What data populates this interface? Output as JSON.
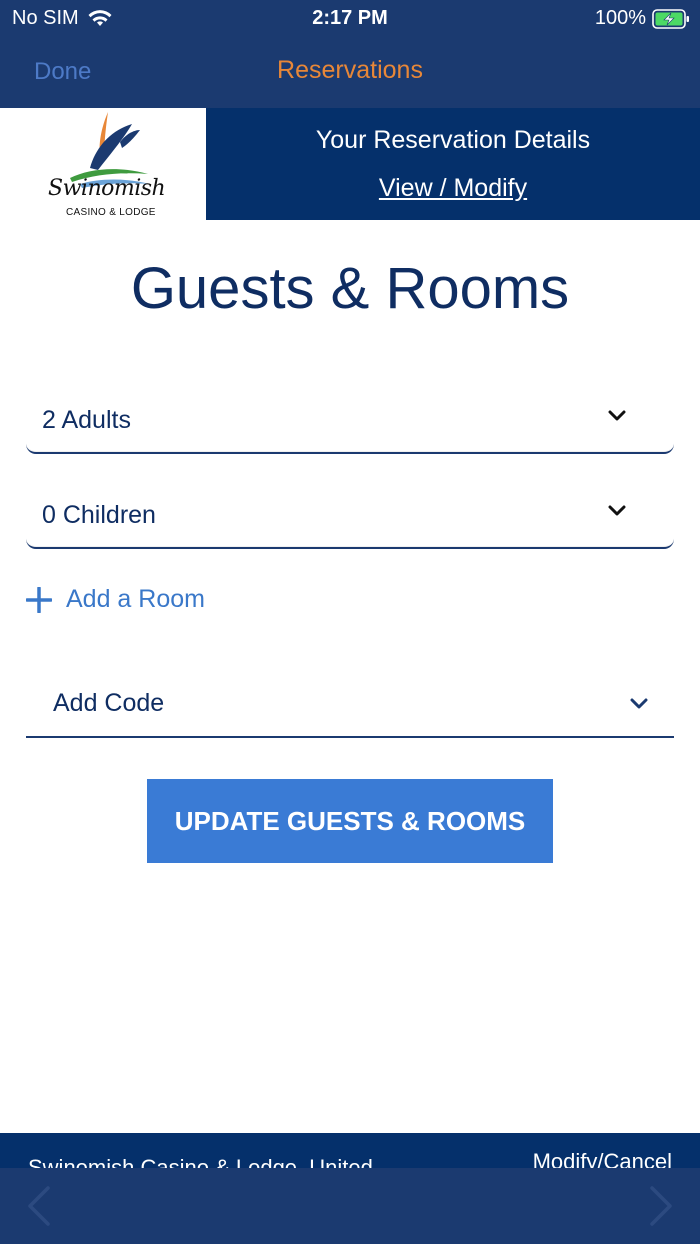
{
  "status_bar": {
    "carrier": "No SIM",
    "time": "2:17 PM",
    "battery": "100%"
  },
  "nav": {
    "done_label": "Done",
    "title": "Reservations"
  },
  "banner": {
    "logo_name": "Swinomish",
    "logo_sub": "CASINO & LODGE",
    "title": "Your Reservation Details",
    "link": "View / Modify"
  },
  "page": {
    "title": "Guests & Rooms"
  },
  "form": {
    "adults": "2 Adults",
    "children": "0 Children",
    "add_room_label": "Add a Room",
    "code_label": "Add Code",
    "update_button": "UPDATE GUESTS & ROOMS"
  },
  "footer": {
    "left_text": "Swinomish Casino & Lodge, United",
    "right_text": "Modify/Cancel"
  },
  "colors": {
    "navy": "#1b3a70",
    "banner_navy": "#05306b",
    "accent_orange": "#e88738",
    "button_blue": "#3a7bd5"
  },
  "icons": {
    "wifi": "wifi-icon",
    "battery": "battery-charging-icon",
    "chevron": "chevron-down-icon",
    "plus": "plus-icon",
    "back": "chevron-left-icon",
    "forward": "chevron-right-icon"
  }
}
